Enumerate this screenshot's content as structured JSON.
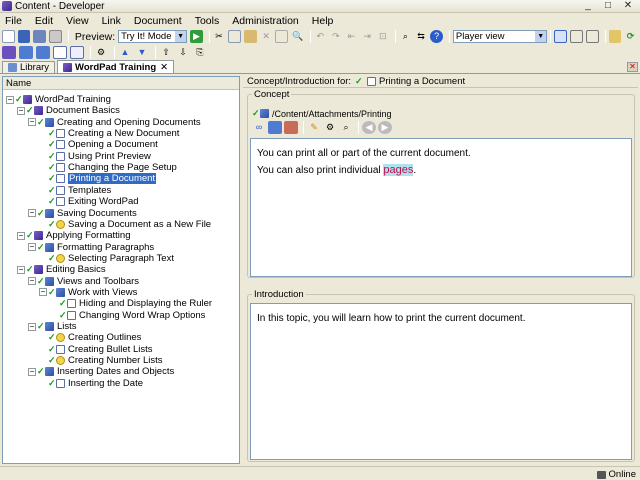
{
  "window": {
    "title": "Content - Developer",
    "controls": [
      "_",
      "□",
      "✕"
    ]
  },
  "menu": [
    "File",
    "Edit",
    "View",
    "Link",
    "Document",
    "Tools",
    "Administration",
    "Help"
  ],
  "toolbar": {
    "preview_label": "Preview:",
    "mode_value": "Try It! Mode",
    "view_value": "Player view"
  },
  "tabs": [
    {
      "label": "Library",
      "active": false
    },
    {
      "label": "WordPad Training",
      "active": true,
      "close": "✕"
    }
  ],
  "tab_close": "✕",
  "tree": {
    "header": "Name",
    "nodes": [
      {
        "label": "WordPad Training",
        "level": 0,
        "kind": "book"
      },
      {
        "label": "Document Basics",
        "level": 1,
        "kind": "book"
      },
      {
        "label": "Creating and Opening Documents",
        "level": 2,
        "kind": "chap"
      },
      {
        "label": "Creating a New Document",
        "level": 3,
        "kind": "page"
      },
      {
        "label": "Opening a Document",
        "level": 3,
        "kind": "page"
      },
      {
        "label": "Using Print Preview",
        "level": 3,
        "kind": "page"
      },
      {
        "label": "Changing the Page Setup",
        "level": 3,
        "kind": "page"
      },
      {
        "label": "Printing a Document",
        "level": 3,
        "kind": "page",
        "selected": true
      },
      {
        "label": "Templates",
        "level": 3,
        "kind": "page"
      },
      {
        "label": "Exiting WordPad",
        "level": 3,
        "kind": "page"
      },
      {
        "label": "Saving Documents",
        "level": 2,
        "kind": "chap"
      },
      {
        "label": "Saving a Document as a New File",
        "level": 3,
        "kind": "concept"
      },
      {
        "label": "Applying Formatting",
        "level": 1,
        "kind": "book"
      },
      {
        "label": "Formatting Paragraphs",
        "level": 2,
        "kind": "chap"
      },
      {
        "label": "Selecting Paragraph Text",
        "level": 3,
        "kind": "concept"
      },
      {
        "label": "Editing Basics",
        "level": 1,
        "kind": "book"
      },
      {
        "label": "Views and Toolbars",
        "level": 2,
        "kind": "chap"
      },
      {
        "label": "Work with Views",
        "level": 3,
        "kind": "chap"
      },
      {
        "label": "Hiding and Displaying the Ruler",
        "level": 4,
        "kind": "page"
      },
      {
        "label": "Changing Word Wrap Options",
        "level": 4,
        "kind": "page"
      },
      {
        "label": "Lists",
        "level": 2,
        "kind": "chap"
      },
      {
        "label": "Creating Outlines",
        "level": 3,
        "kind": "concept"
      },
      {
        "label": "Creating Bullet Lists",
        "level": 3,
        "kind": "page"
      },
      {
        "label": "Creating Number Lists",
        "level": 3,
        "kind": "concept"
      },
      {
        "label": "Inserting Dates and Objects",
        "level": 2,
        "kind": "chap"
      },
      {
        "label": "Inserting the Date",
        "level": 3,
        "kind": "page"
      }
    ]
  },
  "concept_header": {
    "label": "Concept/Introduction for:",
    "document": "Printing a Document"
  },
  "concept": {
    "title": "Concept",
    "path": "/Content/Attachments/Printing",
    "line1": "You can print all or part of the current document.",
    "line2_prefix": "You can also print individual",
    "line2_link": "pages",
    "line2_suffix": "."
  },
  "introduction": {
    "title": "Introduction",
    "text": "In this topic, you will learn how to print the current document."
  },
  "status": {
    "online": "Online"
  },
  "colors": {
    "selection": "#316ac5",
    "check": "#1a9a1a",
    "highlight_bg": "#aee2ef",
    "highlight_fg": "#c0104b"
  }
}
